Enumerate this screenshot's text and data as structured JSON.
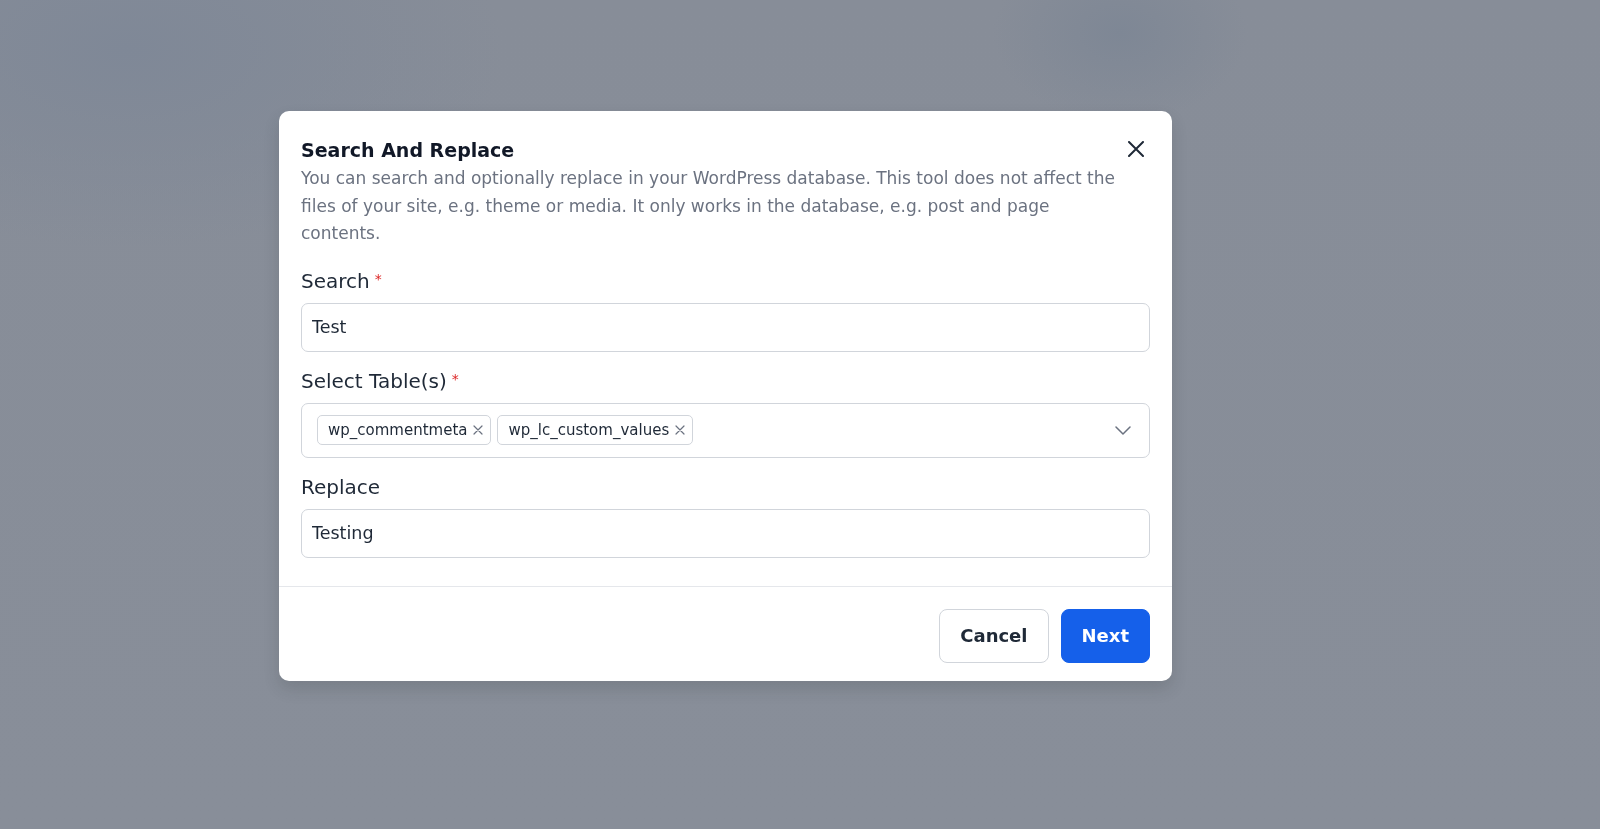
{
  "dialog": {
    "title": "Search And Replace",
    "description": "You can search and optionally replace in your WordPress database. This tool does not affect the files of your site, e.g. theme or media. It only works in the database, e.g. post and page contents.",
    "fields": [
      {
        "kind": "text",
        "label": "Search",
        "required_mark": "*",
        "value": "Test"
      },
      {
        "kind": "multiselect",
        "label": "Select Table(s)",
        "required_mark": "*",
        "tags": [
          "wp_commentmeta",
          "wp_lc_custom_values"
        ]
      },
      {
        "kind": "text",
        "label": "Replace",
        "value": "Testing"
      }
    ],
    "buttons": [
      {
        "kind": "secondary",
        "label": "Cancel"
      },
      {
        "kind": "primary",
        "label": "Next"
      }
    ]
  }
}
